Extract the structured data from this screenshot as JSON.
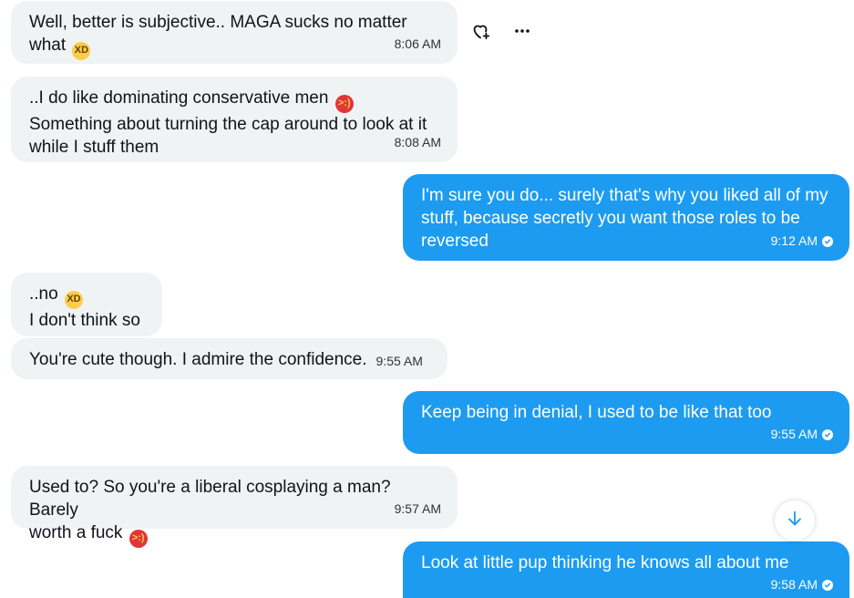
{
  "messages": [
    {
      "text_1": "Well, better is subjective.. MAGA sucks no matter",
      "text_2": "what",
      "emoji": "laughing-emoji",
      "time": "8:06 AM"
    },
    {
      "text_1": "..I do like dominating conservative men",
      "emoji": "devil-emoji",
      "text_2": "Something about turning the cap around to look at it",
      "text_3": "while I stuff them",
      "time": "8:08 AM"
    },
    {
      "text_1": "I'm sure you do... surely that's why you liked all of my",
      "text_2": "stuff, because secretly you want those roles to be",
      "text_3": "reversed",
      "time": "9:12 AM"
    },
    {
      "text_1": "..no",
      "emoji": "laughing-emoji",
      "text_2": "I don't think so"
    },
    {
      "text_1": "You're cute though. I admire the confidence.",
      "time": "9:55 AM"
    },
    {
      "text_1": "Keep being in denial, I used to be like that too",
      "time": "9:55 AM"
    },
    {
      "text_1": "Used to? So you're a liberal cosplaying a man? Barely",
      "text_2": "worth a fuck",
      "emoji": "devil-emoji",
      "time": "9:57 AM"
    },
    {
      "text_1": "Look at little pup thinking he knows all about me",
      "time": "9:58 AM"
    }
  ],
  "icons": {
    "react": "heart-plus-icon",
    "more": "more-icon",
    "scroll": "arrow-down-icon",
    "sent": "check-circle-icon"
  },
  "colors": {
    "incoming_bg": "#eff3f4",
    "outgoing_bg": "#1d9bf0",
    "accent": "#1d9bf0"
  }
}
